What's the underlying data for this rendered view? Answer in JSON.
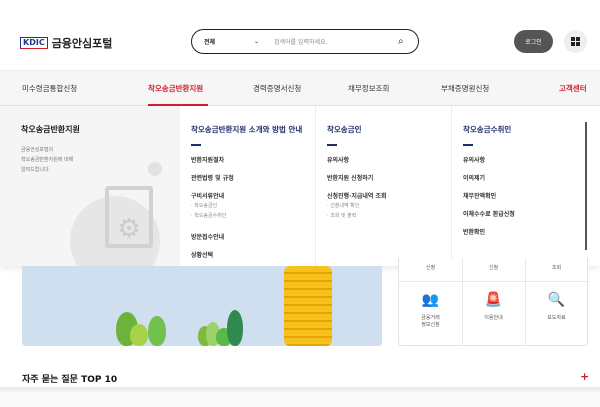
{
  "header": {
    "logo_mark": "KDIC",
    "logo_text": "금융안심포털",
    "search_scope": "전체",
    "search_placeholder": "검색어를 입력하세요.",
    "login": "로그인"
  },
  "nav": {
    "items": [
      "미수령금통합신청",
      "착오송금반환지원",
      "경력증명서신청",
      "채무정보조회",
      "부채증명원신청",
      "고객센터"
    ],
    "active": "착오송금반환지원"
  },
  "mega": {
    "title": "착오송금반환지원",
    "desc": [
      "금융안심포털의",
      "착오송금반환지원에 대해",
      "알려드립니다."
    ],
    "columns": [
      {
        "title": "착오송금반환지원 소개와 방법 안내",
        "items": [
          "반환지원절차",
          "관련법령 및 규정",
          "구비서류안내"
        ],
        "subs": [
          "착오송금인",
          "착오송금수취인"
        ],
        "items2": [
          "방문접수안내",
          "상황선택"
        ]
      },
      {
        "title": "착오송금인",
        "items": [
          "유의사항",
          "반환지원 신청하기",
          "신청진행·지급내역 조회"
        ],
        "subs": [
          "신청내역 확인",
          "조회 및 출력"
        ]
      },
      {
        "title": "착오송금수취인",
        "items": [
          "유의사항",
          "이의제기",
          "채무잔액확인",
          "이체수수료 환급신청",
          "반환확인"
        ]
      }
    ]
  },
  "quick": {
    "top": [
      "신청",
      "신청",
      "조회"
    ],
    "items": [
      {
        "label": "금융거래\n정보신청",
        "icon": "handshake-icon"
      },
      {
        "label": "이용안내",
        "icon": "siren-icon"
      },
      {
        "label": "보도자료",
        "icon": "document-search-icon"
      }
    ]
  },
  "faq": {
    "title": "자주 묻는 질문 TOP 10"
  },
  "colors": {
    "accent": "#d21f2c",
    "navy": "#1c2f6b"
  }
}
